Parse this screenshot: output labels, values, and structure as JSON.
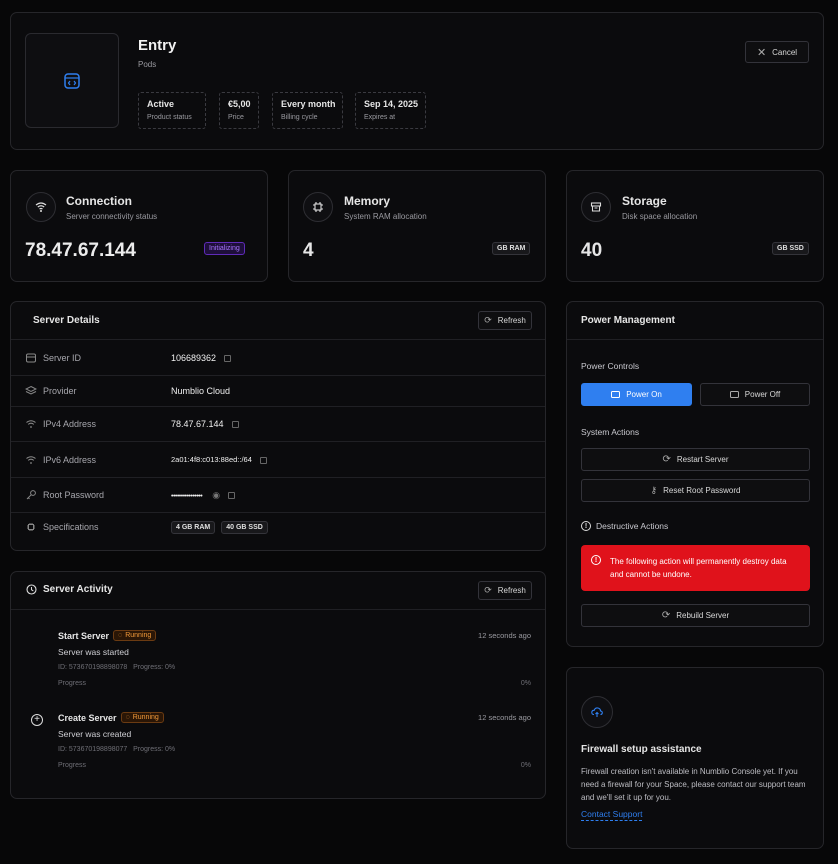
{
  "entry": {
    "title": "Entry",
    "subtitle": "Pods",
    "cancel_label": "Cancel",
    "stats": [
      {
        "value": "Active",
        "label": "Product status"
      },
      {
        "value": "€5,00",
        "label": "Price"
      },
      {
        "value": "Every month",
        "label": "Billing cycle"
      },
      {
        "value": "Sep 14, 2025",
        "label": "Expires at"
      }
    ]
  },
  "connection": {
    "title": "Connection",
    "subtitle": "Server connectivity status",
    "value": "78.47.67.144",
    "badge": "Initializing"
  },
  "memory": {
    "title": "Memory",
    "subtitle": "System RAM allocation",
    "value": "4",
    "badge": "GB RAM"
  },
  "storage": {
    "title": "Storage",
    "subtitle": "Disk space allocation",
    "value": "40",
    "badge": "GB SSD"
  },
  "details": {
    "title": "Server Details",
    "refresh_label": "Refresh",
    "server_id": {
      "label": "Server ID",
      "value": "106689362"
    },
    "provider": {
      "label": "Provider",
      "value": "Numblio Cloud"
    },
    "ipv4": {
      "label": "IPv4 Address",
      "value": "78.47.67.144"
    },
    "ipv6": {
      "label": "IPv6 Address",
      "value": "2a01:4f8:c013:88ed::/64"
    },
    "root_password": {
      "label": "Root Password",
      "value": "••••••••••••••••"
    },
    "specs": {
      "label": "Specifications",
      "ram": "4 GB RAM",
      "ssd": "40 GB SSD"
    }
  },
  "activity": {
    "title": "Server Activity",
    "refresh_label": "Refresh",
    "items": [
      {
        "title": "Start Server",
        "status": "Running",
        "time": "12 seconds ago",
        "desc": "Server was started",
        "meta": "ID: 573670198898078   Progress: 0%",
        "progress_label": "Progress",
        "progress_value": "0%"
      },
      {
        "title": "Create Server",
        "status": "Running",
        "time": "12 seconds ago",
        "desc": "Server was created",
        "meta": "ID: 573670198898077   Progress: 0%",
        "progress_label": "Progress",
        "progress_value": "0%"
      }
    ]
  },
  "power": {
    "title": "Power Management",
    "controls_label": "Power Controls",
    "power_on": "Power On",
    "power_off": "Power Off",
    "system_actions_label": "System Actions",
    "restart": "Restart Server",
    "reset_password": "Reset Root Password",
    "destructive_label": "Destructive Actions",
    "warning": "The following action will permanently destroy data and cannot be undone.",
    "rebuild": "Rebuild Server"
  },
  "firewall": {
    "title": "Firewall setup assistance",
    "text": "Firewall creation isn't available in Numblio Console yet. If you need a firewall for your Space, please contact our support team and we'll set it up for you.",
    "link": "Contact Support"
  },
  "colors": {
    "accent": "#2f7ff0",
    "danger": "#e0121b",
    "initializing": "#8a4dff",
    "running": "#f29a3a"
  }
}
